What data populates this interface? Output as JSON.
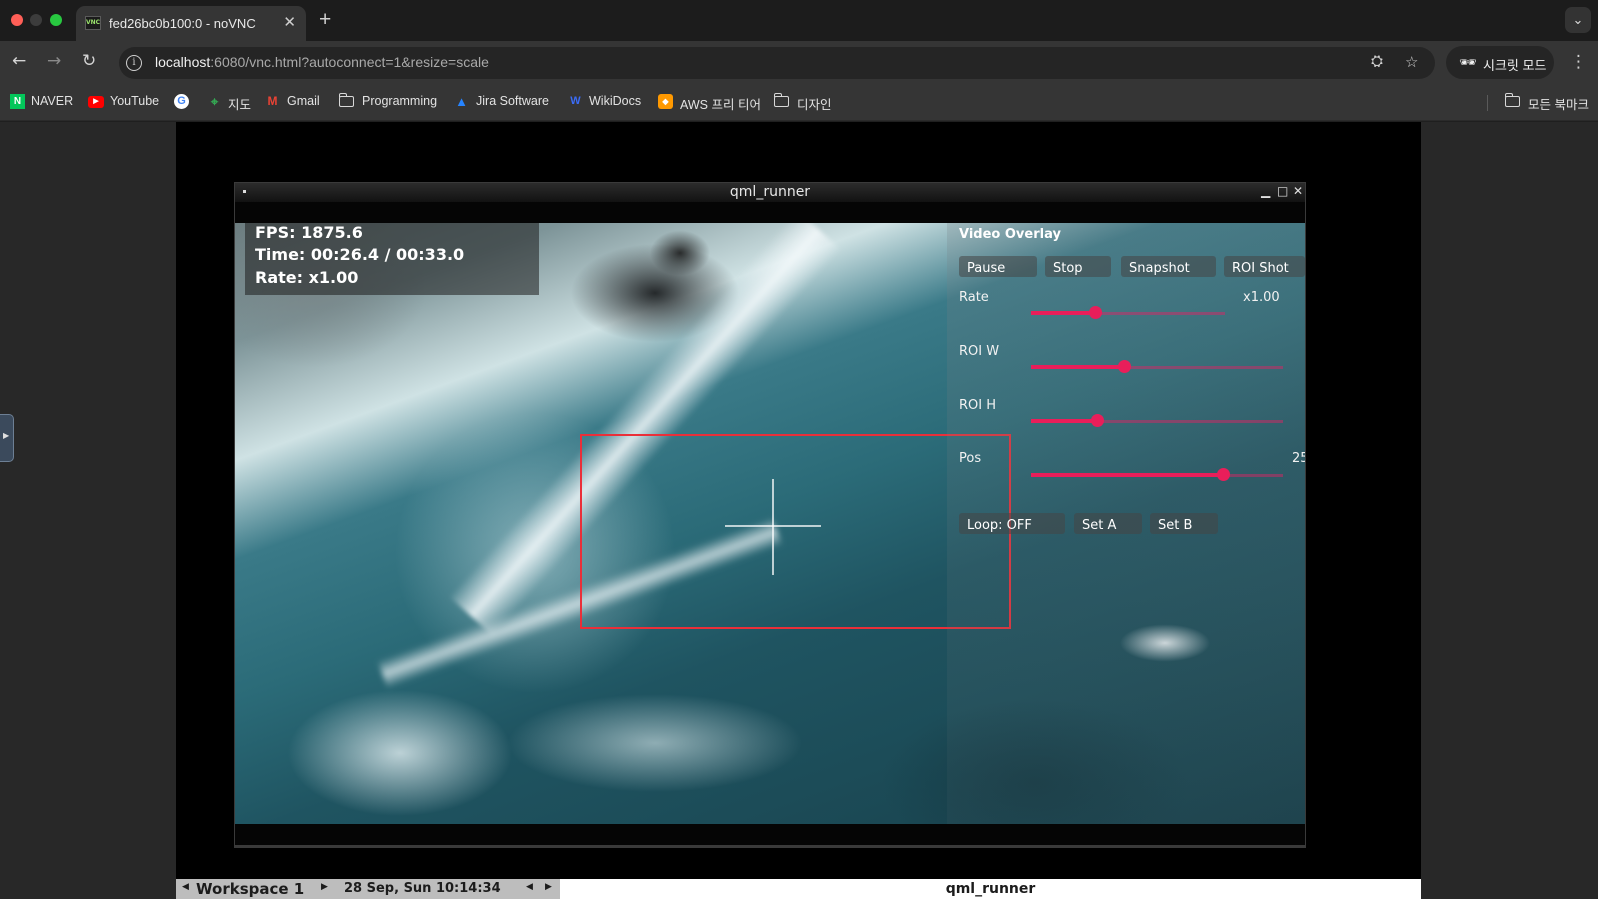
{
  "browser": {
    "tab_title": "fed26bc0b100:0 - noVNC",
    "tab_favicon_text": "VNC",
    "url_host": "localhost",
    "url_rest": ":6080/vnc.html?autoconnect=1&resize=scale",
    "incognito_label": "시크릿 모드",
    "bookmarks": [
      {
        "label": "NAVER",
        "icon": "naver-icon",
        "color": "#03c75a"
      },
      {
        "label": "YouTube",
        "icon": "youtube-icon",
        "color": "#ff0000"
      },
      {
        "label": "",
        "icon": "google-icon",
        "color": "#ffffff"
      },
      {
        "label": "지도",
        "icon": "maps-icon",
        "color": "#34a853"
      },
      {
        "label": "Gmail",
        "icon": "gmail-icon",
        "color": "#ea4335"
      },
      {
        "label": "Programming",
        "icon": "folder-icon",
        "color": "#d8d8d8"
      },
      {
        "label": "Jira Software",
        "icon": "jira-icon",
        "color": "#2684ff"
      },
      {
        "label": "WikiDocs",
        "icon": "wikidocs-icon",
        "color": "#3b6cf6"
      },
      {
        "label": "AWS 프리 티어",
        "icon": "aws-icon",
        "color": "#ff9900"
      },
      {
        "label": "디자인",
        "icon": "folder-icon",
        "color": "#d8d8d8"
      }
    ],
    "all_bookmarks_label": "모든 북마크"
  },
  "qml_window": {
    "title": "qml_runner"
  },
  "stats": {
    "fps": "FPS: 1875.6",
    "time": "Time: 00:26.4 / 00:33.0",
    "rate": "Rate: x1.00"
  },
  "overlay": {
    "title": "Video Overlay",
    "buttons": {
      "pause": "Pause",
      "stop": "Stop",
      "snapshot": "Snapshot",
      "roi_shot": "ROI Shot",
      "loop": "Loop: OFF",
      "set_a": "Set A",
      "set_b": "Set B"
    },
    "sliders": [
      {
        "label": "Rate",
        "value_text": "x1.00",
        "fraction": 0.33
      },
      {
        "label": "ROI W",
        "value_text": "",
        "fraction": 0.37
      },
      {
        "label": "ROI H",
        "value_text": "",
        "fraction": 0.26
      },
      {
        "label": "Pos",
        "value_text": "25",
        "fraction": 0.76
      }
    ],
    "accent_color": "#e91e5a",
    "roi_color": "#ea2f39"
  },
  "wm": {
    "workspace": "Workspace 1",
    "clock": "28 Sep, Sun 10:14:34",
    "task": "qml_runner"
  }
}
